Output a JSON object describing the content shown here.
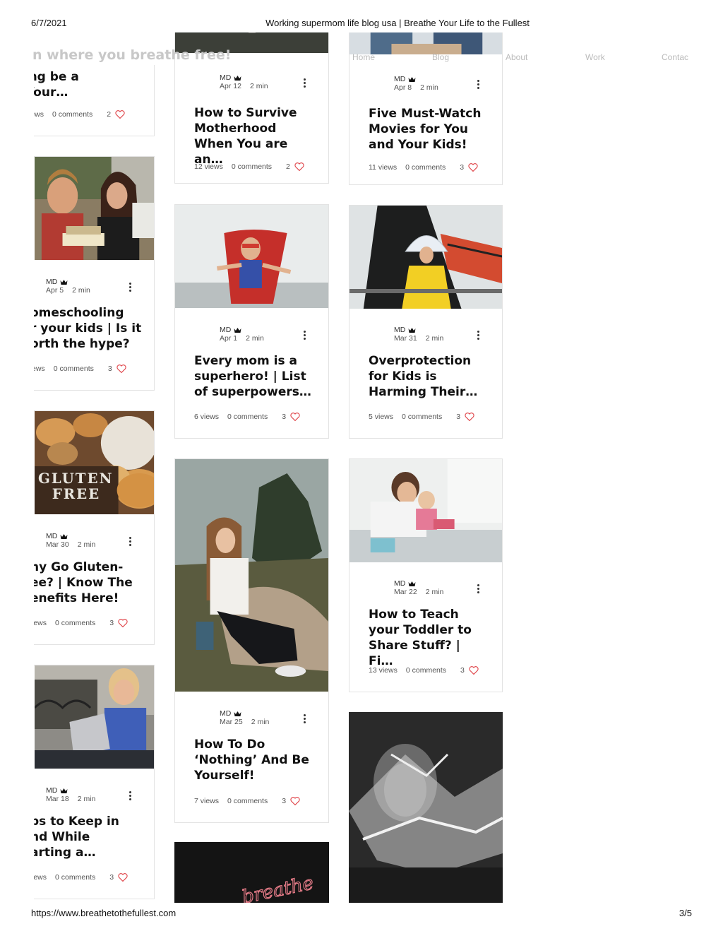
{
  "print": {
    "date": "6/7/2021",
    "title": "Working supermom life blog usa | Breathe Your Life to the Fullest",
    "url": "https://www.breathetothefullest.com",
    "page": "3/5"
  },
  "header": {
    "tagline": "n where you breathe free!",
    "nav": [
      "Home",
      "Blog",
      "About",
      "Work",
      "Contac"
    ]
  },
  "left_column": [
    {
      "title": "avelling be a\nrt of Your…",
      "views": "iews",
      "comments": "0 comments",
      "likes": "2"
    },
    {
      "author": "MD",
      "date": "Apr 5",
      "read": "2 min",
      "title": "omeschooling\nr your kids | Is it\north the hype?",
      "views": "ews",
      "comments": "0 comments",
      "likes": "3"
    },
    {
      "author": "MD",
      "date": "Mar 30",
      "read": "2 min",
      "title": "hy Go Gluten-\nee? | Know The\nenefits Here!",
      "views": "iews",
      "comments": "0 comments",
      "likes": "3"
    },
    {
      "author": "MD",
      "date": "Mar 18",
      "read": "2 min",
      "title": "ps to Keep in\nnd While\narting a…",
      "views": "iews",
      "comments": "0 comments",
      "likes": "3"
    }
  ],
  "posts": [
    {
      "author": "MD",
      "date": "Apr 12",
      "read": "2 min",
      "title": "How to Survive Motherhood When You are an…",
      "views": "12 views",
      "comments": "0 comments",
      "likes": "2"
    },
    {
      "author": "MD",
      "date": "Apr 8",
      "read": "2 min",
      "title": "Five Must-Watch Movies for You and Your Kids!",
      "views": "11 views",
      "comments": "0 comments",
      "likes": "3"
    },
    {
      "author": "MD",
      "date": "Apr 1",
      "read": "2 min",
      "title": "Every mom is a superhero!  | List of superpowers…",
      "views": "6 views",
      "comments": "0 comments",
      "likes": "3"
    },
    {
      "author": "MD",
      "date": "Mar 31",
      "read": "2 min",
      "title": "Overprotection for Kids is Harming Their…",
      "views": "5 views",
      "comments": "0 comments",
      "likes": "3"
    },
    {
      "author": "MD",
      "date": "Mar 25",
      "read": "2 min",
      "title": "How To Do ‘Nothing’ And Be Yourself!",
      "views": "7 views",
      "comments": "0 comments",
      "likes": "3"
    },
    {
      "author": "MD",
      "date": "Mar 22",
      "read": "2 min",
      "title": "How to Teach your Toddler to Share Stuff? | Fi…",
      "views": "13 views",
      "comments": "0 comments",
      "likes": "3"
    }
  ],
  "image_text": {
    "gluten": "GLUTEN\nFREE",
    "neon": "breathe"
  },
  "colors": {
    "heart": "#e0474c",
    "accent": "#111111"
  }
}
